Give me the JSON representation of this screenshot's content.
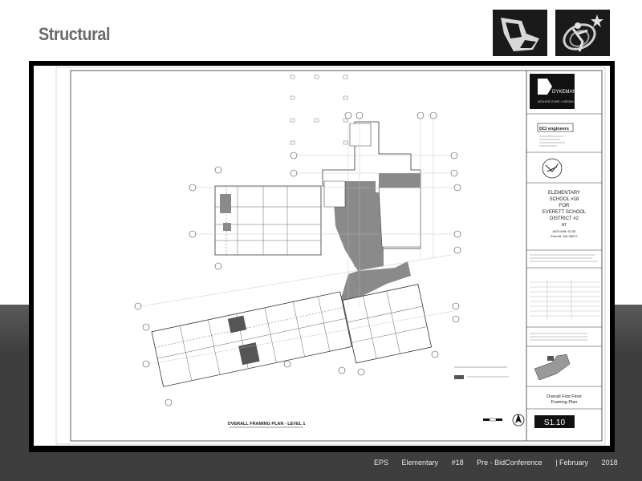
{
  "slide": {
    "title": "Structural"
  },
  "title_block": {
    "firm": "DYKEMAN",
    "firm_tagline": "ARCHITECTURE + DESIGN",
    "consultant": "DCI engineers",
    "project_lines": [
      "ELEMENTARY",
      "SCHOOL #18",
      "FOR",
      "EVERETT SCHOOL",
      "DISTRICT #2",
      "AT"
    ],
    "address_lines": [
      "4875 69th St SE",
      "Everett, WA 98272"
    ],
    "sheet_title_lines": [
      "Overall First Floor",
      "Framing Plan"
    ],
    "sheet_number": "S1.10"
  },
  "drawing": {
    "plan_title": "OVERALL FRAMING PLAN - LEVEL 1"
  },
  "footer": {
    "org": "EPS",
    "project": "Elementary",
    "number": "#18",
    "event": "Pre - BidConference",
    "month": "| February",
    "year": "2018"
  },
  "colors": {
    "title_gray": "#6a6a6a",
    "band_dark": "#3e3e3e",
    "hatch_gray": "#8a8a8a"
  }
}
